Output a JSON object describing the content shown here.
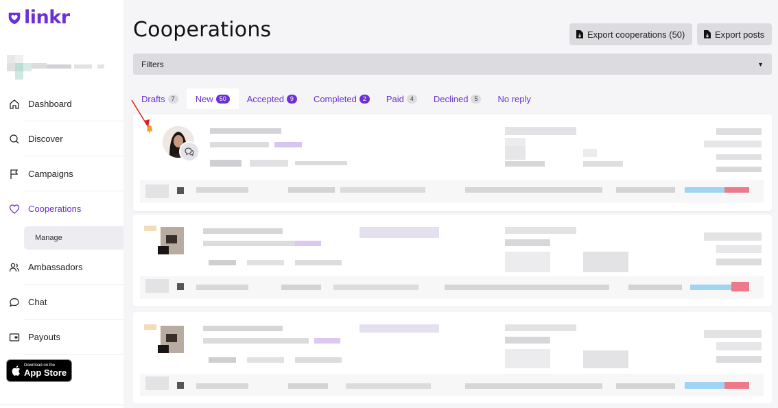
{
  "app": {
    "logo_text": "linkr"
  },
  "sidebar": {
    "items": [
      {
        "label": "Dashboard",
        "icon": "home-icon"
      },
      {
        "label": "Discover",
        "icon": "search-icon"
      },
      {
        "label": "Campaigns",
        "icon": "flag-icon"
      },
      {
        "label": "Cooperations",
        "icon": "heart-icon",
        "active": true
      },
      {
        "label": "Ambassadors",
        "icon": "users-icon"
      },
      {
        "label": "Chat",
        "icon": "chat-icon"
      },
      {
        "label": "Payouts",
        "icon": "wallet-icon"
      }
    ],
    "sub_item": "Manage",
    "app_store": {
      "small": "Download on the",
      "big": "App Store"
    }
  },
  "header": {
    "title": "Cooperations",
    "export_coop": "Export cooperations (50)",
    "export_posts": "Export posts"
  },
  "filters": {
    "label": "Filters"
  },
  "tabs": [
    {
      "label": "Drafts",
      "count": "7"
    },
    {
      "label": "New",
      "count": "50",
      "active": true
    },
    {
      "label": "Accepted",
      "count": "9"
    },
    {
      "label": "Completed",
      "count": "2"
    },
    {
      "label": "Paid",
      "count": "4"
    },
    {
      "label": "Declined",
      "count": "5"
    },
    {
      "label": "No reply",
      "count": ""
    }
  ],
  "colors": {
    "accent": "#6d2fd6",
    "bell": "#f0a12a",
    "arrow": "#e02020"
  }
}
